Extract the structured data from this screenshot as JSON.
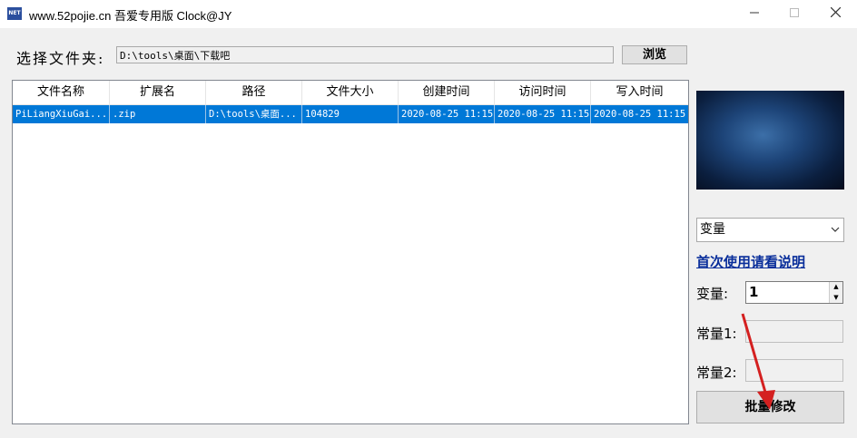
{
  "titlebar": {
    "icon_text": "NET",
    "title": "www.52pojie.cn 吾爱专用版   Clock@JY",
    "minimize_icon": "minimize-icon",
    "maximize_icon": "maximize-icon",
    "close_icon": "close-icon"
  },
  "folder": {
    "label": "选择文件夹:",
    "path": "D:\\tools\\桌面\\下载吧",
    "browse_label": "浏览"
  },
  "table": {
    "columns": [
      "文件名称",
      "扩展名",
      "路径",
      "文件大小",
      "创建时间",
      "访问时间",
      "写入时间"
    ],
    "rows": [
      [
        "PiLiangXiuGai...",
        ".zip",
        "D:\\tools\\桌面...",
        "104829",
        "2020-08-25 11:15",
        "2020-08-25 11:15",
        "2020-08-25 11:15"
      ]
    ],
    "selected_row": 0,
    "selection_color": "#0078d7"
  },
  "side": {
    "mode_select": "变量",
    "help_link": "首次使用请看说明",
    "var_label": "变量:",
    "var_value": "1",
    "const1_label": "常量1:",
    "const1_value": "",
    "const2_label": "常量2:",
    "const2_value": "",
    "batch_label": "批量修改"
  },
  "colors": {
    "accent": "#0078d7",
    "link": "#0a2f9b",
    "annotation_arrow": "#d42020"
  }
}
